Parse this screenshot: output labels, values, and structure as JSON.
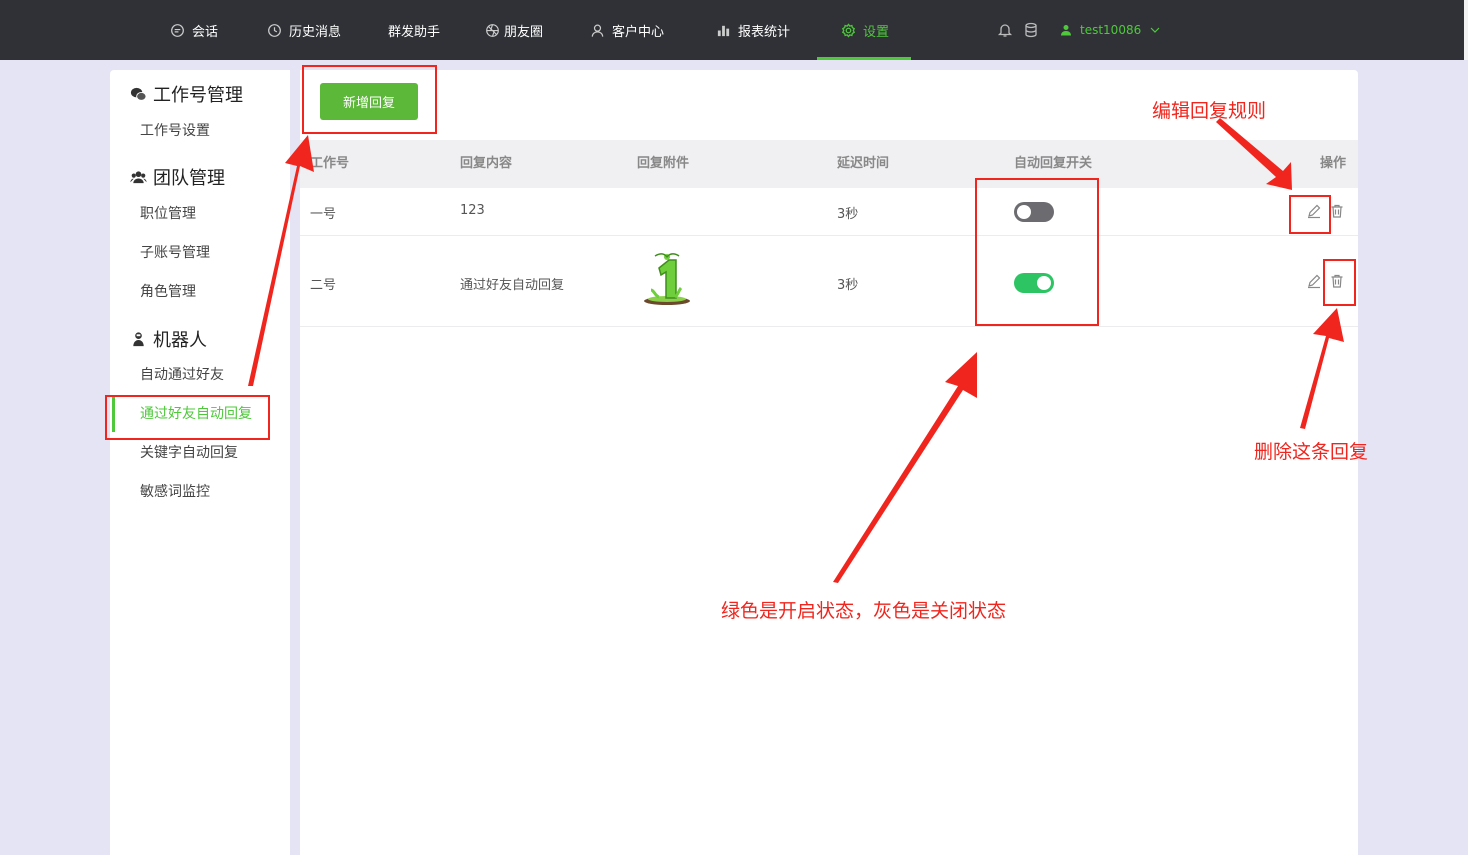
{
  "nav": {
    "items": [
      {
        "label": "会话"
      },
      {
        "label": "历史消息"
      },
      {
        "label": "群发助手"
      },
      {
        "label": "朋友圈"
      },
      {
        "label": "客户中心"
      },
      {
        "label": "报表统计"
      },
      {
        "label": "设置",
        "active": true
      }
    ],
    "user": "test10086",
    "accent_color": "#4fc83c"
  },
  "sidebar": {
    "sections": [
      {
        "title": "工作号管理",
        "icon": "wechat-icon",
        "items": [
          "工作号设置"
        ]
      },
      {
        "title": "团队管理",
        "icon": "team-icon",
        "items": [
          "职位管理",
          "子账号管理",
          "角色管理"
        ]
      },
      {
        "title": "机器人",
        "icon": "robot-icon",
        "items": [
          "自动通过好友",
          "通过好友自动回复",
          "关键字自动回复",
          "敏感词监控"
        ]
      }
    ],
    "active_item": "通过好友自动回复"
  },
  "main": {
    "add_button": "新增回复",
    "columns": [
      "工作号",
      "回复内容",
      "回复附件",
      "延迟时间",
      "自动回复开关",
      "操作"
    ],
    "rows": [
      {
        "account": "一号",
        "content": "123",
        "attachment": "",
        "delay": "3秒",
        "auto_reply_on": false
      },
      {
        "account": "二号",
        "content": "通过好友自动回复",
        "attachment": "green-number-one-sticker",
        "delay": "3秒",
        "auto_reply_on": true
      }
    ],
    "toggle_on_color": "#2dc464",
    "toggle_off_color": "#6c6c70"
  },
  "annotations": {
    "edit_rule": "编辑回复规则",
    "delete_reply": "删除这条回复",
    "toggle_explain": "绿色是开启状态，灰色是关闭状态",
    "color": "#f0261e"
  }
}
